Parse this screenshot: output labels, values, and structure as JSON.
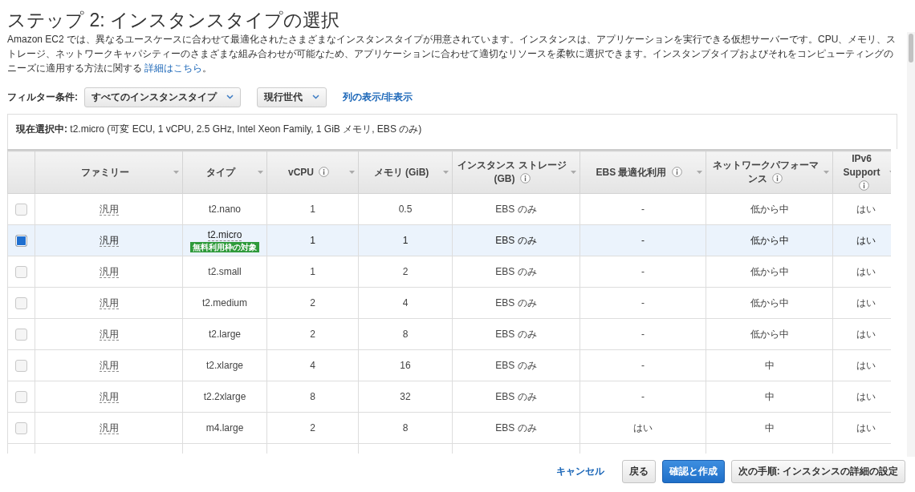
{
  "title": "ステップ 2: インスタンスタイプの選択",
  "description": {
    "text": "Amazon EC2 では、異なるユースケースに合わせて最適化されたさまざまなインスタンスタイプが用意されています。インスタンスは、アプリケーションを実行できる仮想サーバーです。CPU、メモリ、ストレージ、ネットワークキャパシティーのさまざまな組み合わせが可能なため、アプリケーションに合わせて適切なリソースを柔軟に選択できます。インスタンプタイプおよびそれをコンピューティングのニーズに適用する方法に関する",
    "link": "詳細はこちら",
    "end": "。"
  },
  "filter": {
    "label": "フィルター条件:",
    "type_select": "すべてのインスタンスタイプ",
    "generation_select": "現行世代",
    "columns_link": "列の表示/非表示"
  },
  "current_selection": "**現在選択中:** t2.micro (可変 ECU, 1 vCPU, 2.5 GHz, Intel Xeon Family, 1 GiB メモリ, EBS のみ)",
  "columns": [
    {
      "label": "ファミリー",
      "info": false
    },
    {
      "label": "タイプ",
      "info": false
    },
    {
      "label": "vCPU",
      "info": true
    },
    {
      "label": "メモリ (GiB)",
      "info": false
    },
    {
      "label": "インスタンス ストレージ (GB)",
      "info": true
    },
    {
      "label": "EBS 最適化利用",
      "info": true
    },
    {
      "label": "ネットワークパフォーマンス",
      "info": true
    },
    {
      "label": "IPv6 Support",
      "info": true
    }
  ],
  "rows": [
    {
      "selected": false,
      "cells": [
        "汎用",
        "t2.nano",
        "1",
        "0.5",
        "EBS のみ",
        "-",
        "低から中",
        "はい"
      ]
    },
    {
      "selected": true,
      "cells": [
        "汎用",
        "t2.micro",
        "1",
        "1",
        "EBS のみ",
        "-",
        "低から中",
        "はい"
      ],
      "badge": "無料利用枠の対象"
    },
    {
      "selected": false,
      "cells": [
        "汎用",
        "t2.small",
        "1",
        "2",
        "EBS のみ",
        "-",
        "低から中",
        "はい"
      ]
    },
    {
      "selected": false,
      "cells": [
        "汎用",
        "t2.medium",
        "2",
        "4",
        "EBS のみ",
        "-",
        "低から中",
        "はい"
      ]
    },
    {
      "selected": false,
      "cells": [
        "汎用",
        "t2.large",
        "2",
        "8",
        "EBS のみ",
        "-",
        "低から中",
        "はい"
      ]
    },
    {
      "selected": false,
      "cells": [
        "汎用",
        "t2.xlarge",
        "4",
        "16",
        "EBS のみ",
        "-",
        "中",
        "はい"
      ]
    },
    {
      "selected": false,
      "cells": [
        "汎用",
        "t2.2xlarge",
        "8",
        "32",
        "EBS のみ",
        "-",
        "中",
        "はい"
      ]
    },
    {
      "selected": false,
      "cells": [
        "汎用",
        "m4.large",
        "2",
        "8",
        "EBS のみ",
        "はい",
        "中",
        "はい"
      ]
    }
  ],
  "footer": {
    "cancel": "キャンセル",
    "back": "戻る",
    "review": "確認と作成",
    "next": "次の手順: インスタンスの詳細の設定"
  }
}
